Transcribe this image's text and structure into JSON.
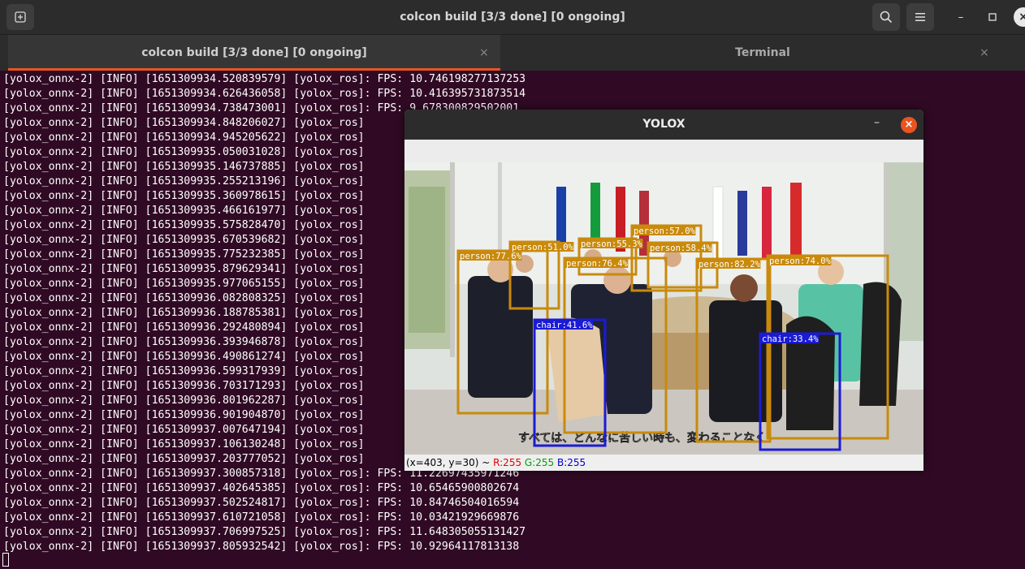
{
  "window": {
    "title": "colcon build [3/3 done] [0 ongoing]"
  },
  "tabs": [
    {
      "label": "colcon build [3/3 done] [0 ongoing]",
      "active": true
    },
    {
      "label": "Terminal",
      "active": false
    }
  ],
  "terminal": {
    "lines": [
      "[yolox_onnx-2] [INFO] [1651309934.520839579] [yolox_ros]: FPS: 10.746198277137253",
      "[yolox_onnx-2] [INFO] [1651309934.626436058] [yolox_ros]: FPS: 10.416395731873514",
      "[yolox_onnx-2] [INFO] [1651309934.738473001] [yolox_ros]: FPS: 9.678300829502001",
      "[yolox_onnx-2] [INFO] [1651309934.848206027] [yolox_ros]",
      "[yolox_onnx-2] [INFO] [1651309934.945205622] [yolox_ros]",
      "[yolox_onnx-2] [INFO] [1651309935.050031028] [yolox_ros]",
      "[yolox_onnx-2] [INFO] [1651309935.146737885] [yolox_ros]",
      "[yolox_onnx-2] [INFO] [1651309935.255213196] [yolox_ros]",
      "[yolox_onnx-2] [INFO] [1651309935.360978615] [yolox_ros]",
      "[yolox_onnx-2] [INFO] [1651309935.466161977] [yolox_ros]",
      "[yolox_onnx-2] [INFO] [1651309935.575828470] [yolox_ros]",
      "[yolox_onnx-2] [INFO] [1651309935.670539682] [yolox_ros]",
      "[yolox_onnx-2] [INFO] [1651309935.775232385] [yolox_ros]",
      "[yolox_onnx-2] [INFO] [1651309935.879629341] [yolox_ros]",
      "[yolox_onnx-2] [INFO] [1651309935.977065155] [yolox_ros]",
      "[yolox_onnx-2] [INFO] [1651309936.082808325] [yolox_ros]",
      "[yolox_onnx-2] [INFO] [1651309936.188785381] [yolox_ros]",
      "[yolox_onnx-2] [INFO] [1651309936.292480894] [yolox_ros]",
      "[yolox_onnx-2] [INFO] [1651309936.393946878] [yolox_ros]",
      "[yolox_onnx-2] [INFO] [1651309936.490861274] [yolox_ros]",
      "[yolox_onnx-2] [INFO] [1651309936.599317939] [yolox_ros]",
      "[yolox_onnx-2] [INFO] [1651309936.703171293] [yolox_ros]",
      "[yolox_onnx-2] [INFO] [1651309936.801962287] [yolox_ros]",
      "[yolox_onnx-2] [INFO] [1651309936.901904870] [yolox_ros]",
      "[yolox_onnx-2] [INFO] [1651309937.007647194] [yolox_ros]",
      "[yolox_onnx-2] [INFO] [1651309937.106130248] [yolox_ros]",
      "[yolox_onnx-2] [INFO] [1651309937.203777052] [yolox_ros]",
      "[yolox_onnx-2] [INFO] [1651309937.300857318] [yolox_ros]: FPS: 11.22697435971246",
      "[yolox_onnx-2] [INFO] [1651309937.402645385] [yolox_ros]: FPS: 10.65465900802674",
      "[yolox_onnx-2] [INFO] [1651309937.502524817] [yolox_ros]: FPS: 10.84746504016594",
      "[yolox_onnx-2] [INFO] [1651309937.610721058] [yolox_ros]: FPS: 10.03421929669876",
      "[yolox_onnx-2] [INFO] [1651309937.706997525] [yolox_ros]: FPS: 11.648305055131427",
      "[yolox_onnx-2] [INFO] [1651309937.805932542] [yolox_ros]: FPS: 10.92964117813138"
    ]
  },
  "yolox_window": {
    "title": "YOLOX",
    "subtitle": "すべては、どんなに苦しい時も、変わることなく",
    "detections": [
      {
        "label": "person:77.6%",
        "cls": "person"
      },
      {
        "label": "person:51.0%",
        "cls": "person"
      },
      {
        "label": "person:55.3%",
        "cls": "person"
      },
      {
        "label": "person:57.0%",
        "cls": "person"
      },
      {
        "label": "person:58.4%",
        "cls": "person"
      },
      {
        "label": "person:76.4%",
        "cls": "person"
      },
      {
        "label": "person:82.2%",
        "cls": "person"
      },
      {
        "label": "person:74.0%",
        "cls": "person"
      },
      {
        "label": "chair:41.6%",
        "cls": "chair"
      },
      {
        "label": "chair:33.4%",
        "cls": "chair"
      }
    ],
    "status": {
      "coords": "(x=403, y=30) ~ ",
      "r": "R:255",
      "g": "G:255",
      "b": "B:255"
    }
  },
  "colors": {
    "person_box": "#c98a0c",
    "chair_box": "#1b1bd4",
    "accent": "#e95420",
    "terminal_bg": "#300a24"
  }
}
